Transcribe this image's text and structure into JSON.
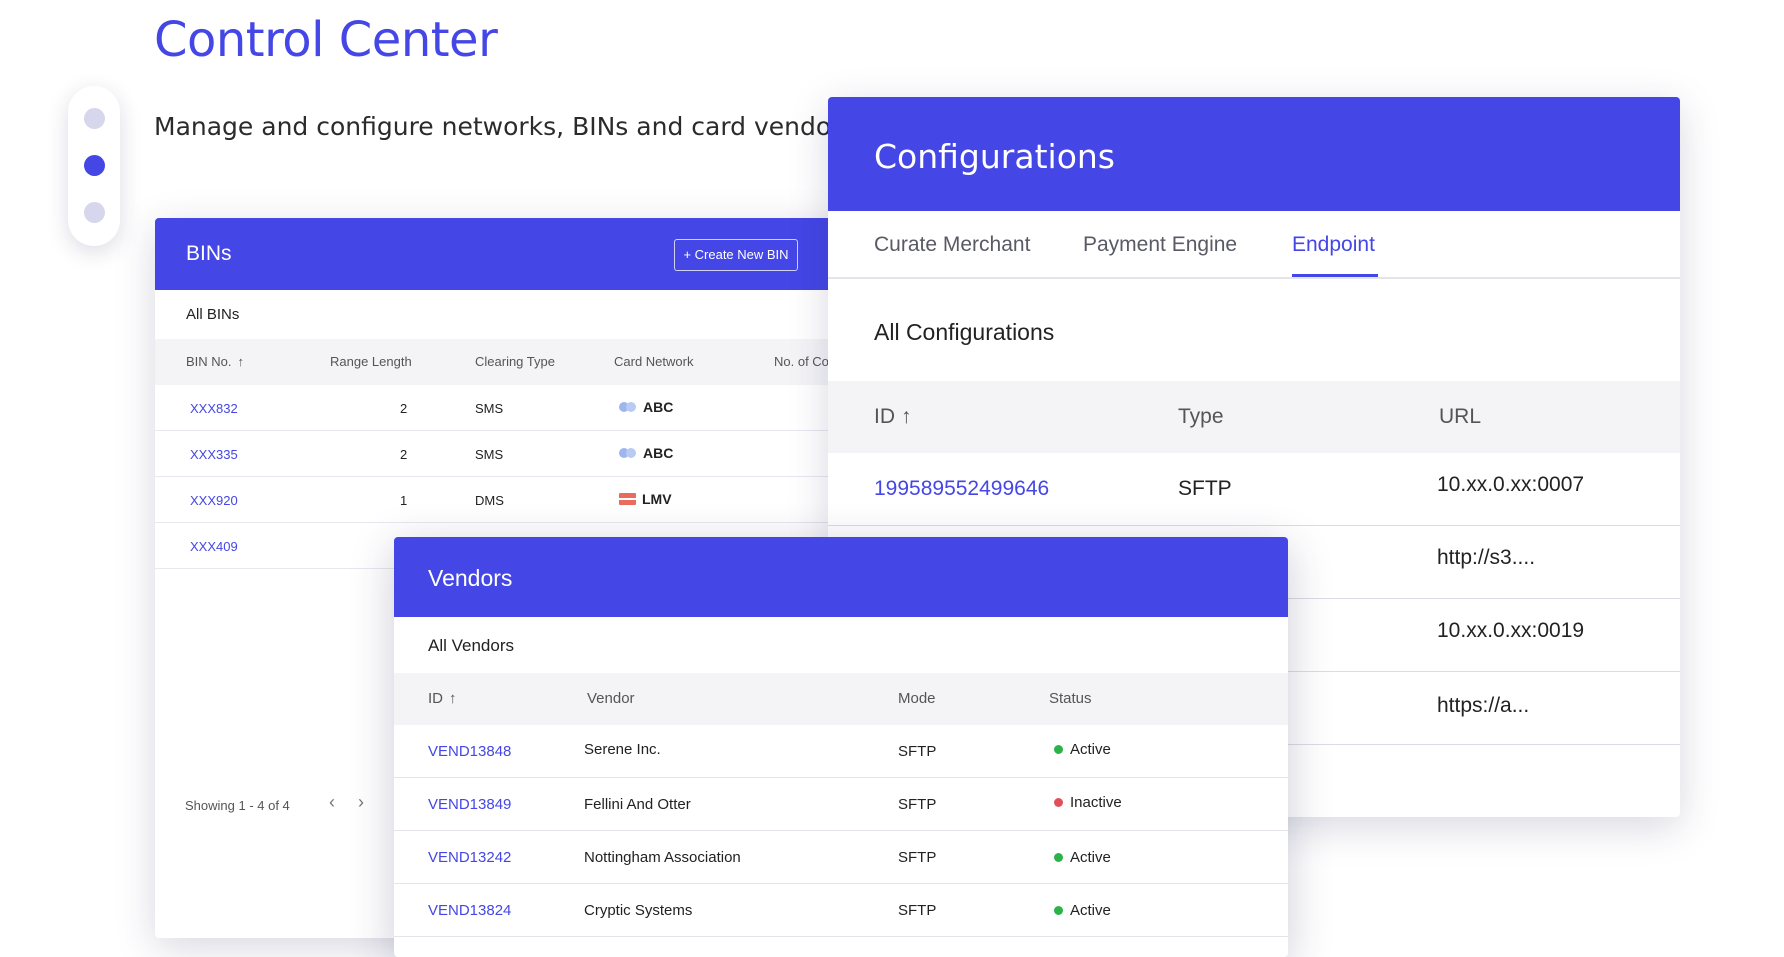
{
  "page": {
    "title": "Control Center",
    "subtitle": "Manage and configure networks, BINs and card vendors"
  },
  "bins": {
    "title": "BINs",
    "create_button": "+ Create New BIN",
    "section_label": "All BINs",
    "columns": [
      "BIN No.",
      "Range Length",
      "Clearing Type",
      "Card Network",
      "No. of Conf"
    ],
    "sort_icon": "↑",
    "rows": [
      {
        "bin": "XXX832",
        "range": "2",
        "clearing": "SMS",
        "network": "ABC",
        "network_icon": "abc-network-icon"
      },
      {
        "bin": "XXX335",
        "range": "2",
        "clearing": "SMS",
        "network": "ABC",
        "network_icon": "abc-network-icon"
      },
      {
        "bin": "XXX920",
        "range": "1",
        "clearing": "DMS",
        "network": "LMV",
        "network_icon": "lmv-network-icon"
      },
      {
        "bin": "XXX409",
        "range": "",
        "clearing": "",
        "network": "",
        "network_icon": ""
      }
    ],
    "footer": "Showing 1 - 4 of 4",
    "prev": "‹",
    "next": "›"
  },
  "configs": {
    "title": "Configurations",
    "tabs": [
      "Curate Merchant",
      "Payment Engine",
      "Endpoint"
    ],
    "active_tab": "Endpoint",
    "section_label": "All Configurations",
    "columns": [
      "ID",
      "Type",
      "URL"
    ],
    "sort_icon": "↑",
    "rows": [
      {
        "id": "199589552499646",
        "type": "SFTP",
        "url": "10.xx.0.xx:0007"
      },
      {
        "id": "",
        "type": "",
        "url": "http://s3...."
      },
      {
        "id": "",
        "type": "",
        "url": "10.xx.0.xx:0019"
      },
      {
        "id": "",
        "type": "",
        "url": "https://a..."
      }
    ]
  },
  "vendors": {
    "title": "Vendors",
    "section_label": "All Vendors",
    "columns": [
      "ID",
      "Vendor",
      "Mode",
      "Status"
    ],
    "sort_icon": "↑",
    "rows": [
      {
        "id": "VEND13848",
        "vendor": "Serene Inc.",
        "mode": "SFTP",
        "status": "Active",
        "status_color": "#2bb34a"
      },
      {
        "id": "VEND13849",
        "vendor": "Fellini And Otter",
        "mode": "SFTP",
        "status": "Inactive",
        "status_color": "#e0505a"
      },
      {
        "id": "VEND13242",
        "vendor": "Nottingham Association",
        "mode": "SFTP",
        "status": "Active",
        "status_color": "#2bb34a"
      },
      {
        "id": "VEND13824",
        "vendor": "Cryptic Systems",
        "mode": "SFTP",
        "status": "Active",
        "status_color": "#2bb34a"
      }
    ]
  },
  "colors": {
    "accent": "#4446e6",
    "active": "#2bb34a",
    "inactive": "#e0505a"
  }
}
